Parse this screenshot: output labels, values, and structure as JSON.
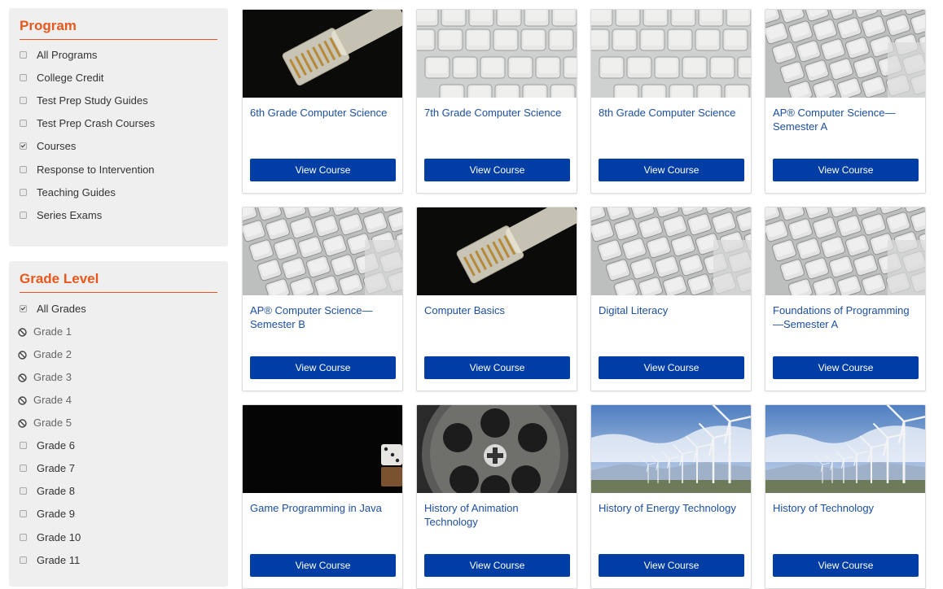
{
  "program": {
    "title": "Program",
    "items": [
      {
        "label": "All Programs",
        "checked": false
      },
      {
        "label": "College Credit",
        "checked": false
      },
      {
        "label": "Test Prep Study Guides",
        "checked": false
      },
      {
        "label": "Test Prep Crash Courses",
        "checked": false
      },
      {
        "label": "Courses",
        "checked": true
      },
      {
        "label": "Response to Intervention",
        "checked": false
      },
      {
        "label": "Teaching Guides",
        "checked": false
      },
      {
        "label": "Series Exams",
        "checked": false
      }
    ]
  },
  "grade": {
    "title": "Grade Level",
    "items": [
      {
        "label": "All Grades",
        "state": "checked"
      },
      {
        "label": "Grade 1",
        "state": "disabled"
      },
      {
        "label": "Grade 2",
        "state": "disabled"
      },
      {
        "label": "Grade 3",
        "state": "disabled"
      },
      {
        "label": "Grade 4",
        "state": "disabled"
      },
      {
        "label": "Grade 5",
        "state": "disabled"
      },
      {
        "label": "Grade 6",
        "state": "unchecked"
      },
      {
        "label": "Grade 7",
        "state": "unchecked"
      },
      {
        "label": "Grade 8",
        "state": "unchecked"
      },
      {
        "label": "Grade 9",
        "state": "unchecked"
      },
      {
        "label": "Grade 10",
        "state": "unchecked"
      },
      {
        "label": "Grade 11",
        "state": "unchecked"
      }
    ]
  },
  "courses": [
    {
      "title": "6th Grade Computer Science",
      "button": "View Course",
      "image": "ethernet-cable-image"
    },
    {
      "title": "7th Grade Computer Science",
      "button": "View Course",
      "image": "keyboard-flat-image"
    },
    {
      "title": "8th Grade Computer Science",
      "button": "View Course",
      "image": "keyboard-flat-image"
    },
    {
      "title": "AP® Computer Science—Semester A",
      "button": "View Course",
      "image": "keyboard-angled-image"
    },
    {
      "title": "AP® Computer Science—Semester B",
      "button": "View Course",
      "image": "keyboard-angled-image"
    },
    {
      "title": "Computer Basics",
      "button": "View Course",
      "image": "ethernet-cable-image"
    },
    {
      "title": "Digital Literacy",
      "button": "View Course",
      "image": "keyboard-angled-image"
    },
    {
      "title": "Foundations of Programming—Semester A",
      "button": "View Course",
      "image": "keyboard-angled-image"
    },
    {
      "title": "Game Programming in Java",
      "button": "View Course",
      "image": "dice-image"
    },
    {
      "title": "History of Animation Technology",
      "button": "View Course",
      "image": "film-reel-image"
    },
    {
      "title": "History of Energy Technology",
      "button": "View Course",
      "image": "wind-turbines-image"
    },
    {
      "title": "History of Technology",
      "button": "View Course",
      "image": "wind-turbines-image"
    }
  ],
  "colors": {
    "accent": "#e8581c",
    "button": "#003da5",
    "link": "#1c4fa1",
    "panel": "#efefef"
  }
}
